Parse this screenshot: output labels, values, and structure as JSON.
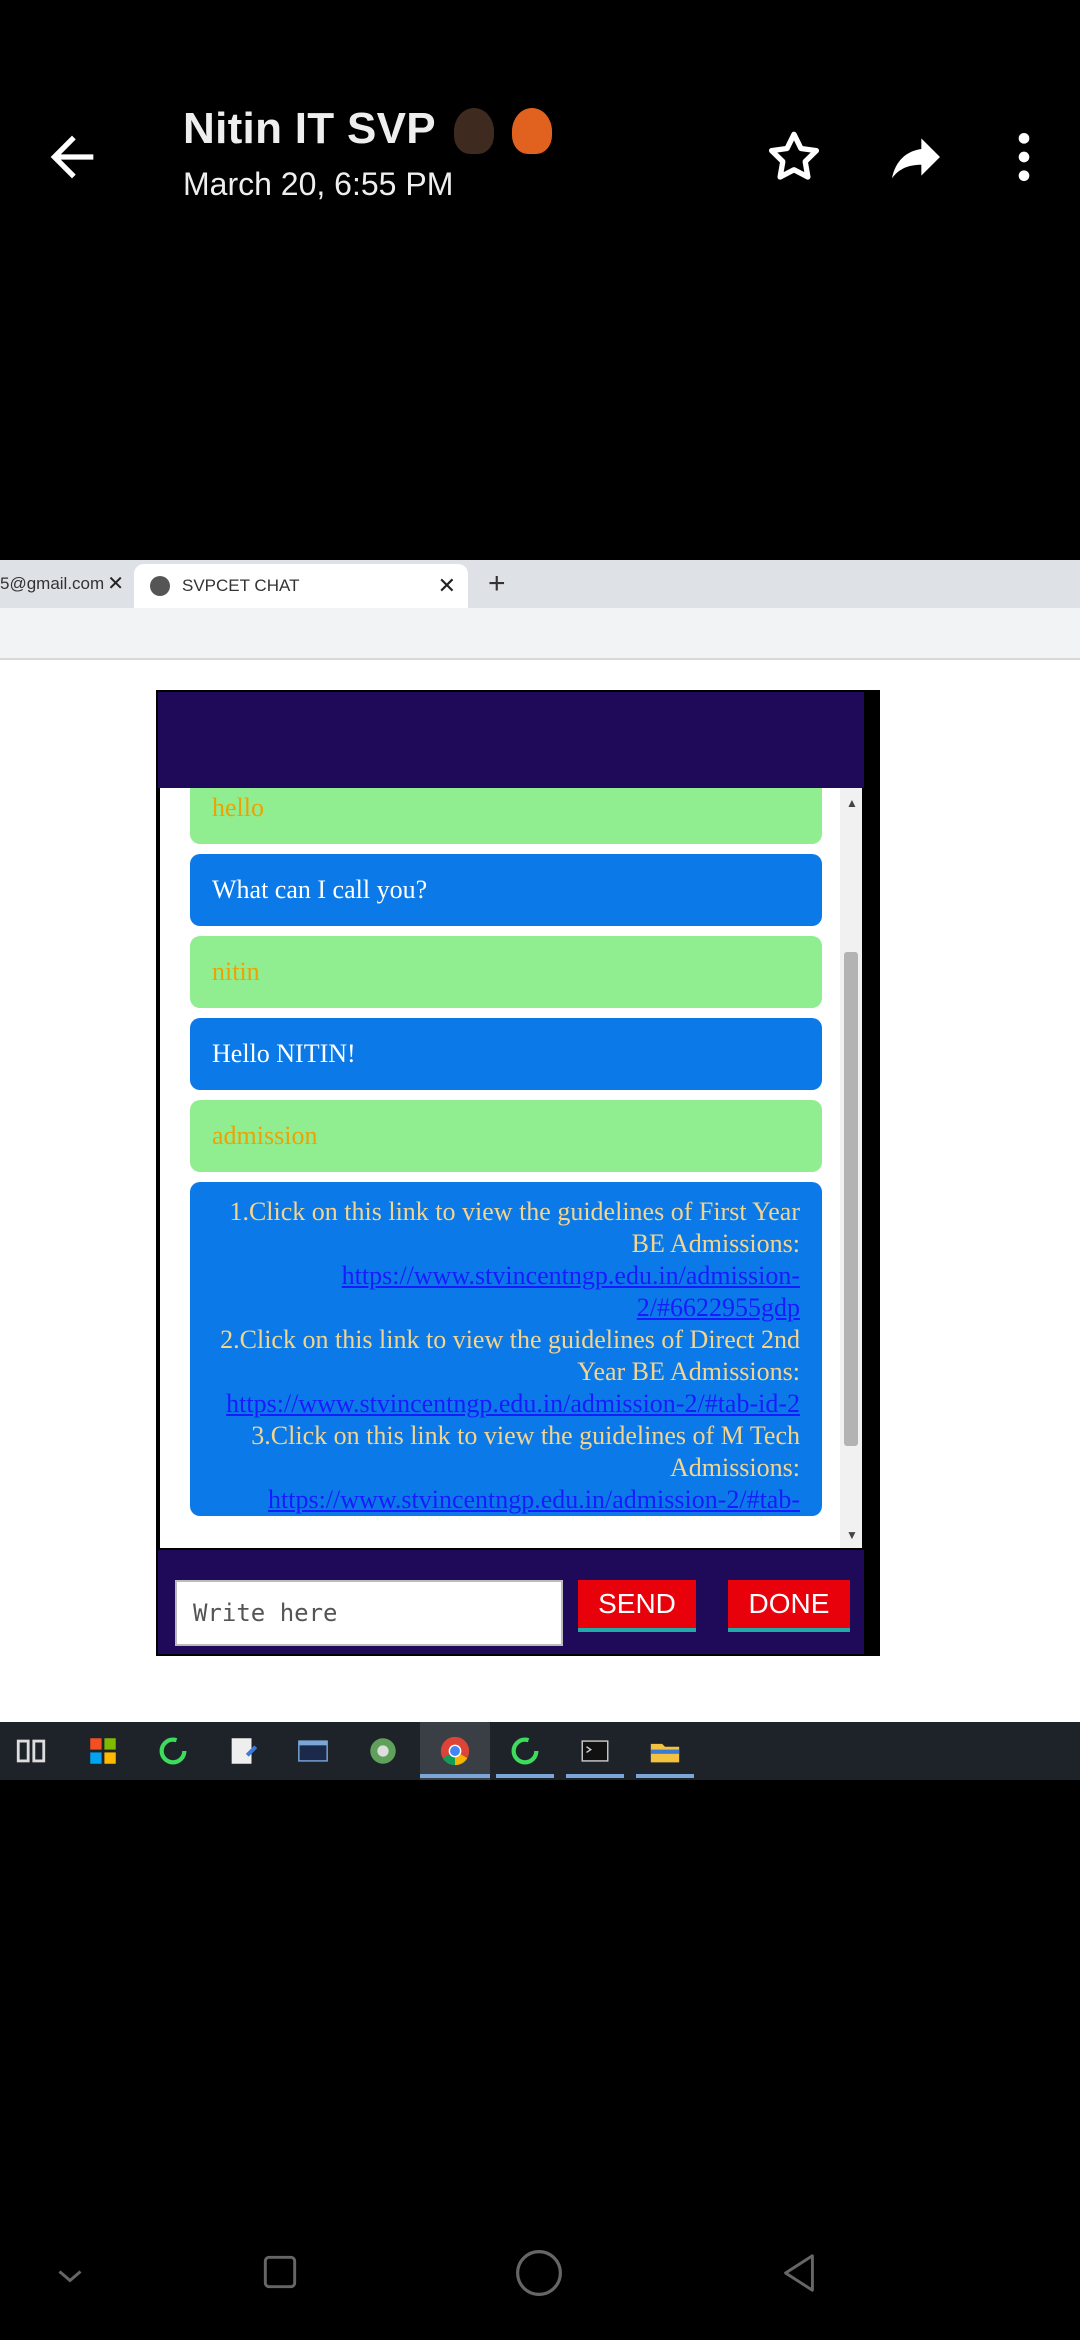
{
  "viewer": {
    "title": "Nitin IT SVP",
    "subtitle": "March 20, 6:55 PM"
  },
  "browser": {
    "tab1_label": "5@gmail.com",
    "tab2_label": "SVPCET CHAT"
  },
  "chat": {
    "messages": [
      {
        "role": "user",
        "text": "hello"
      },
      {
        "role": "bot",
        "text": "What can I call you?"
      },
      {
        "role": "user",
        "text": "nitin"
      },
      {
        "role": "bot",
        "text": "Hello NITIN!"
      },
      {
        "role": "user",
        "text": "admission"
      }
    ],
    "long": {
      "line1": "1.Click on this link to view the guidelines of First Year BE Admissions:",
      "link1": "https://www.stvincentngp.edu.in/admission-2/#6622955gdp",
      "line2": "2.Click on this link to view the guidelines of Direct 2nd Year BE Admissions:",
      "link2": "https://www.stvincentngp.edu.in/admission-2/#tab-id-2",
      "line3": "3.Click on this link to view the guidelines of M Tech Admissions:",
      "link3": "https://www.stvincentngp.edu.in/admission-2/#tab-"
    },
    "input_placeholder": "Write here",
    "send_label": "SEND",
    "done_label": "DONE"
  }
}
